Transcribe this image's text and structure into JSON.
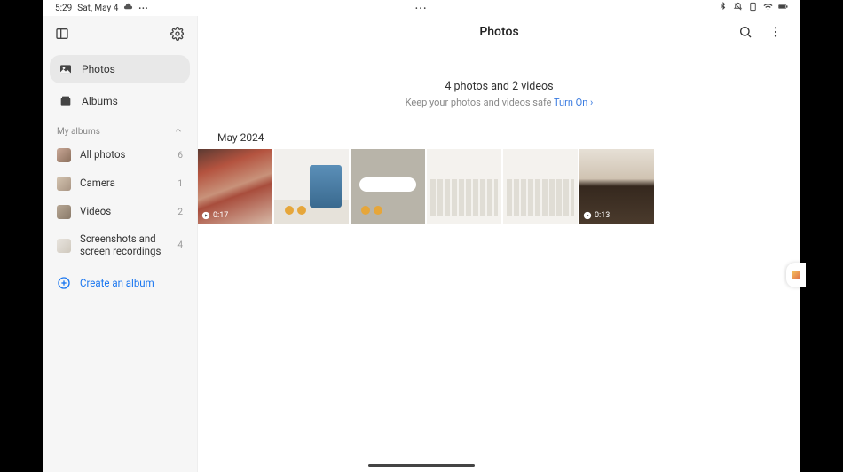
{
  "statusbar": {
    "time": "5:29",
    "date": "Sat, May 4",
    "dots": "•••"
  },
  "sidebar": {
    "nav": [
      {
        "label": "Photos"
      },
      {
        "label": "Albums"
      }
    ],
    "sectionTitle": "My albums",
    "albums": [
      {
        "label": "All photos",
        "count": "6"
      },
      {
        "label": "Camera",
        "count": "1"
      },
      {
        "label": "Videos",
        "count": "2"
      },
      {
        "label": "Screenshots and screen recordings",
        "count": "4"
      }
    ],
    "createLabel": "Create an album"
  },
  "main": {
    "title": "Photos",
    "info": {
      "summary": "4 photos and 2 videos",
      "subtext": "Keep your photos and videos safe ",
      "linkText": "Turn On ›"
    },
    "dateGroup": "May 2024",
    "items": [
      {
        "type": "video",
        "duration": "0:17"
      },
      {
        "type": "photo"
      },
      {
        "type": "photo"
      },
      {
        "type": "photo"
      },
      {
        "type": "photo"
      },
      {
        "type": "video",
        "duration": "0:13"
      }
    ]
  }
}
